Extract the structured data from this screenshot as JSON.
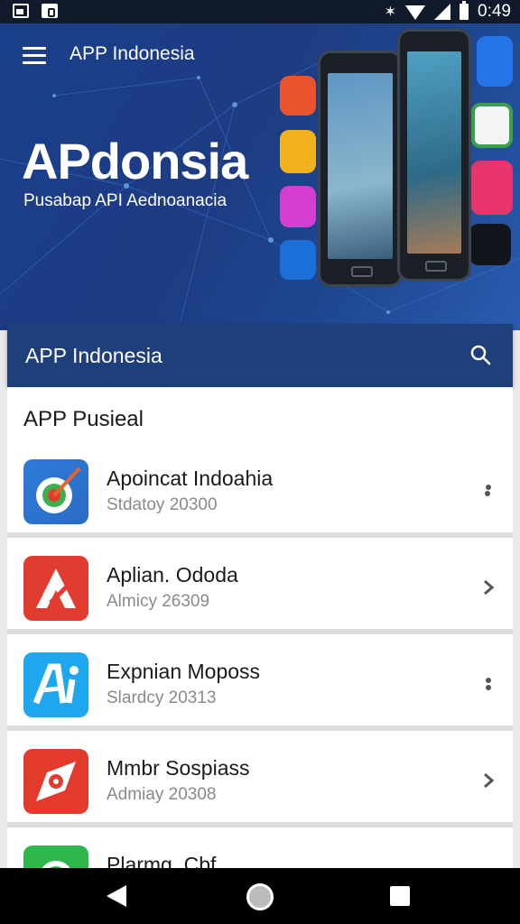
{
  "status_bar": {
    "time": "0:49"
  },
  "header": {
    "title": "APP Indonesia",
    "hero_title": "APdonsia",
    "hero_subtitle": "Pusabap API Aednoanacia"
  },
  "search_bar": {
    "label": "APP Indonesia"
  },
  "list": {
    "section_title": "APP Pusieal",
    "items": [
      {
        "name": "Apoincat Indoahia",
        "meta": "Stdatoy 20300"
      },
      {
        "name": "Aplian. Ododa",
        "meta": "Almicy 26309"
      },
      {
        "name": "Expnian Moposs",
        "meta": "Slardcy 20313"
      },
      {
        "name": "Mmbr Sospiass",
        "meta": "Admiay 20308"
      },
      {
        "name": "Plarmg. Cbf",
        "meta": ""
      }
    ]
  },
  "colors": {
    "header_bg": "#1f3f7a",
    "hero_bg": "#1d3c83",
    "icon_blue_target": "#2f7ad9",
    "icon_red": "#e23b2f",
    "icon_light_blue": "#1ea6ef",
    "icon_green": "#2eb84b"
  }
}
